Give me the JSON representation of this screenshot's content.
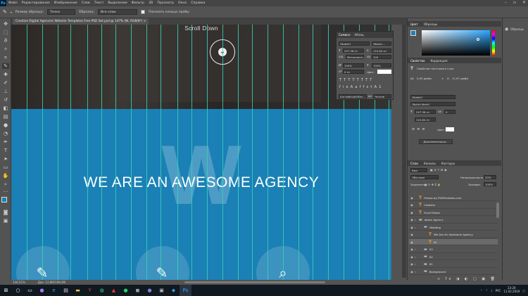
{
  "app": {
    "menu": [
      "Файл",
      "Редактирование",
      "Изображение",
      "Слои",
      "Текст",
      "Выделение",
      "Фильтр",
      "3D",
      "Просмотр",
      "Окно",
      "Справка"
    ],
    "logo": "Ps"
  },
  "options": {
    "sample_size_label": "Размер образца:",
    "sample_size_value": "Точка",
    "sample_label": "Образец:",
    "sample_value": "Все слои",
    "show_ring_label": "Показать кольцо пробы"
  },
  "document": {
    "tab_title": "Creative Digital Agencies Website Templates Free PSD Set.psd @ 147% (W, RGB/8*) ×",
    "zoom": "146,51%",
    "doc_info": "Док: 12,8М/198,4М"
  },
  "canvas": {
    "scroll_text": "Scroll Down",
    "big_letter": "W",
    "headline": "WE ARE AN AWESOME AGENCY"
  },
  "colors": {
    "guide": "#35d2b6",
    "brand_blue": "#1b80b5",
    "accent": "#31a8ff"
  },
  "character_panel": {
    "tabs": [
      "Символ",
      "Абзац"
    ],
    "font_family": "[Nobile]",
    "font_style": "[Bold(c...",
    "size": "247,38 пт",
    "leading": "124,64 пт",
    "tracking_mode": "Метрически",
    "tracking": "100",
    "vscale": "100%",
    "hscale": "100%",
    "baseline": "0 пт",
    "color_label": "Цвет:",
    "language": "Английский:Вел...",
    "aa": "Четкое"
  },
  "color_panel": {
    "tabs": [
      "Цвет",
      "Образцы"
    ]
  },
  "properties_panel": {
    "tabs": [
      "Свойства",
      "Коррекция"
    ],
    "kind": "Свойства текстового слоя",
    "w_label": "Ш:",
    "w_value": "9,95 дюйм",
    "x_label": "X:",
    "x_value": "11,97 дюйм",
    "font": "[Nobile]",
    "style": "[Bold(c)Italic]",
    "size": "247,38 пт",
    "tracking": "0",
    "extra_size": "124,64 пт",
    "color_label": "Цвет:",
    "more_button": "Дополнительно..."
  },
  "layers_panel": {
    "tabs": [
      "Слои",
      "Каналы",
      "Контуры"
    ],
    "filter_label": "Вид",
    "blend_mode": "Обычные",
    "opacity_label": "Непрозрачность:",
    "opacity": "20%",
    "lock_label": "Закрепить:",
    "fill_label": "Заливка:",
    "fill": "100%",
    "layers": [
      {
        "name": "Freose by PSDFreebies.com",
        "type": "text",
        "indent": 0
      },
      {
        "name": "Cowbrio",
        "type": "text",
        "indent": 0
      },
      {
        "name": "Scroll Down",
        "type": "text",
        "indent": 0
      },
      {
        "name": "about Agency",
        "type": "folder",
        "indent": 0
      },
      {
        "name": "Heading",
        "type": "folder",
        "indent": 1
      },
      {
        "name": "We Are An Awesome Agency",
        "type": "text",
        "indent": 2
      },
      {
        "name": "W",
        "type": "text",
        "indent": 2,
        "selected": true
      },
      {
        "name": "03",
        "type": "folder",
        "indent": 1
      },
      {
        "name": "02",
        "type": "folder",
        "indent": 1
      },
      {
        "name": "01",
        "type": "folder",
        "indent": 1
      },
      {
        "name": "Background",
        "type": "folder",
        "indent": 1
      }
    ]
  },
  "far_right": {
    "label": "Образцы"
  },
  "taskbar": {
    "lang": "РУС",
    "time": "23:20",
    "date": "11.02.2019"
  }
}
